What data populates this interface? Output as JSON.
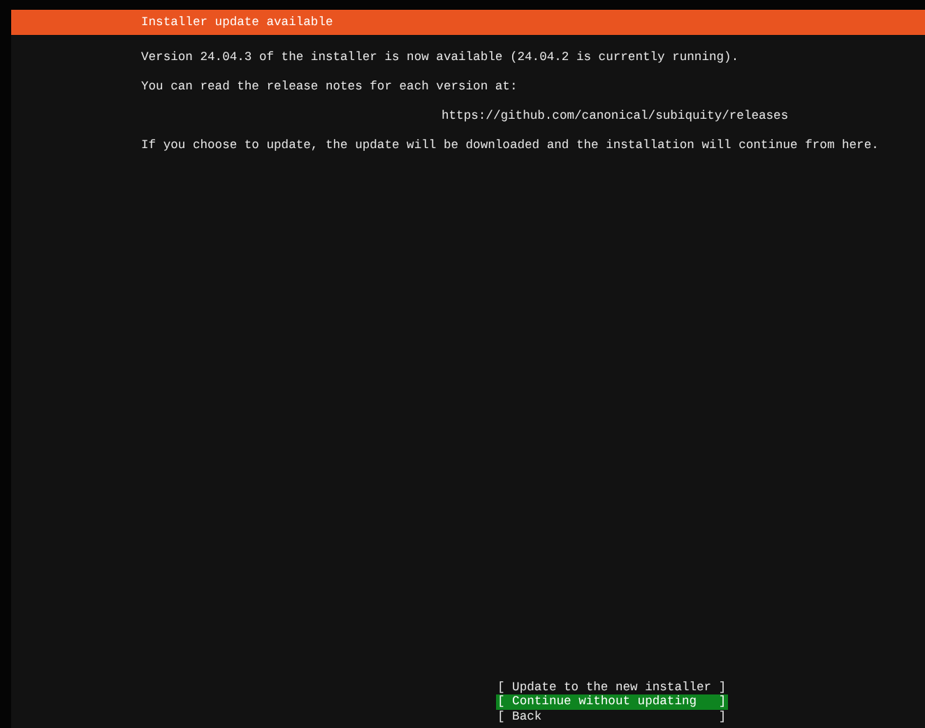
{
  "header": {
    "title": "Installer update available"
  },
  "body": [
    {
      "kind": "para",
      "text": "Version 24.04.3 of the installer is now available (24.04.2 is currently running)."
    },
    {
      "kind": "para",
      "text": "You can read the release notes for each version at:"
    },
    {
      "kind": "link",
      "text": "https://github.com/canonical/subiquity/releases"
    },
    {
      "kind": "para",
      "text": "If you choose to update, the update will be downloaded and the installation will continue from here."
    }
  ],
  "buttons": [
    {
      "label": "[ Update to the new installer ]",
      "selected": false
    },
    {
      "label": "[ Continue without updating   ]",
      "selected": true
    },
    {
      "label": "[ Back                        ]",
      "selected": false
    }
  ]
}
